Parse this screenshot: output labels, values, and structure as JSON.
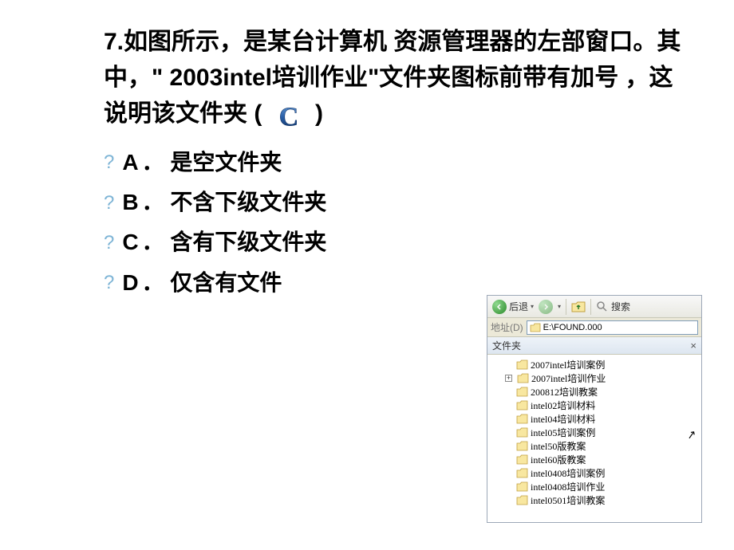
{
  "question": {
    "prefix": "7.如图所示，是某台计算机 资源管理器的左部窗口。其中，\"  2003intel培训作业\"文件夹图标前带有加号 ，这说明该文件夹 (",
    "suffix": ")",
    "answer": "C"
  },
  "options": {
    "a_letter": "A",
    "a_text": "．  是空文件夹",
    "b_letter": "B",
    "b_text": "．  不含下级文件夹",
    "c_letter": "C",
    "c_text": "．  含有下级文件夹",
    "d_letter": "D",
    "d_text": "．  仅含有文件"
  },
  "explorer": {
    "back": "后退",
    "search": "搜索",
    "addr_label": "地址(D)",
    "addr_path": "E:\\FOUND.000",
    "tree_header": "文件夹",
    "items": [
      {
        "label": "2007intel培训案例",
        "plus": false
      },
      {
        "label": "2007intel培训作业",
        "plus": true
      },
      {
        "label": "200812培训教案",
        "plus": false
      },
      {
        "label": "intel02培训材料",
        "plus": false
      },
      {
        "label": "intel04培训材料",
        "plus": false
      },
      {
        "label": "intel05培训案例",
        "plus": false
      },
      {
        "label": "intel50版教案",
        "plus": false
      },
      {
        "label": "intel60版教案",
        "plus": false
      },
      {
        "label": "intel0408培训案例",
        "plus": false
      },
      {
        "label": "intel0408培训作业",
        "plus": false
      },
      {
        "label": "intel0501培训教案",
        "plus": false
      }
    ]
  }
}
